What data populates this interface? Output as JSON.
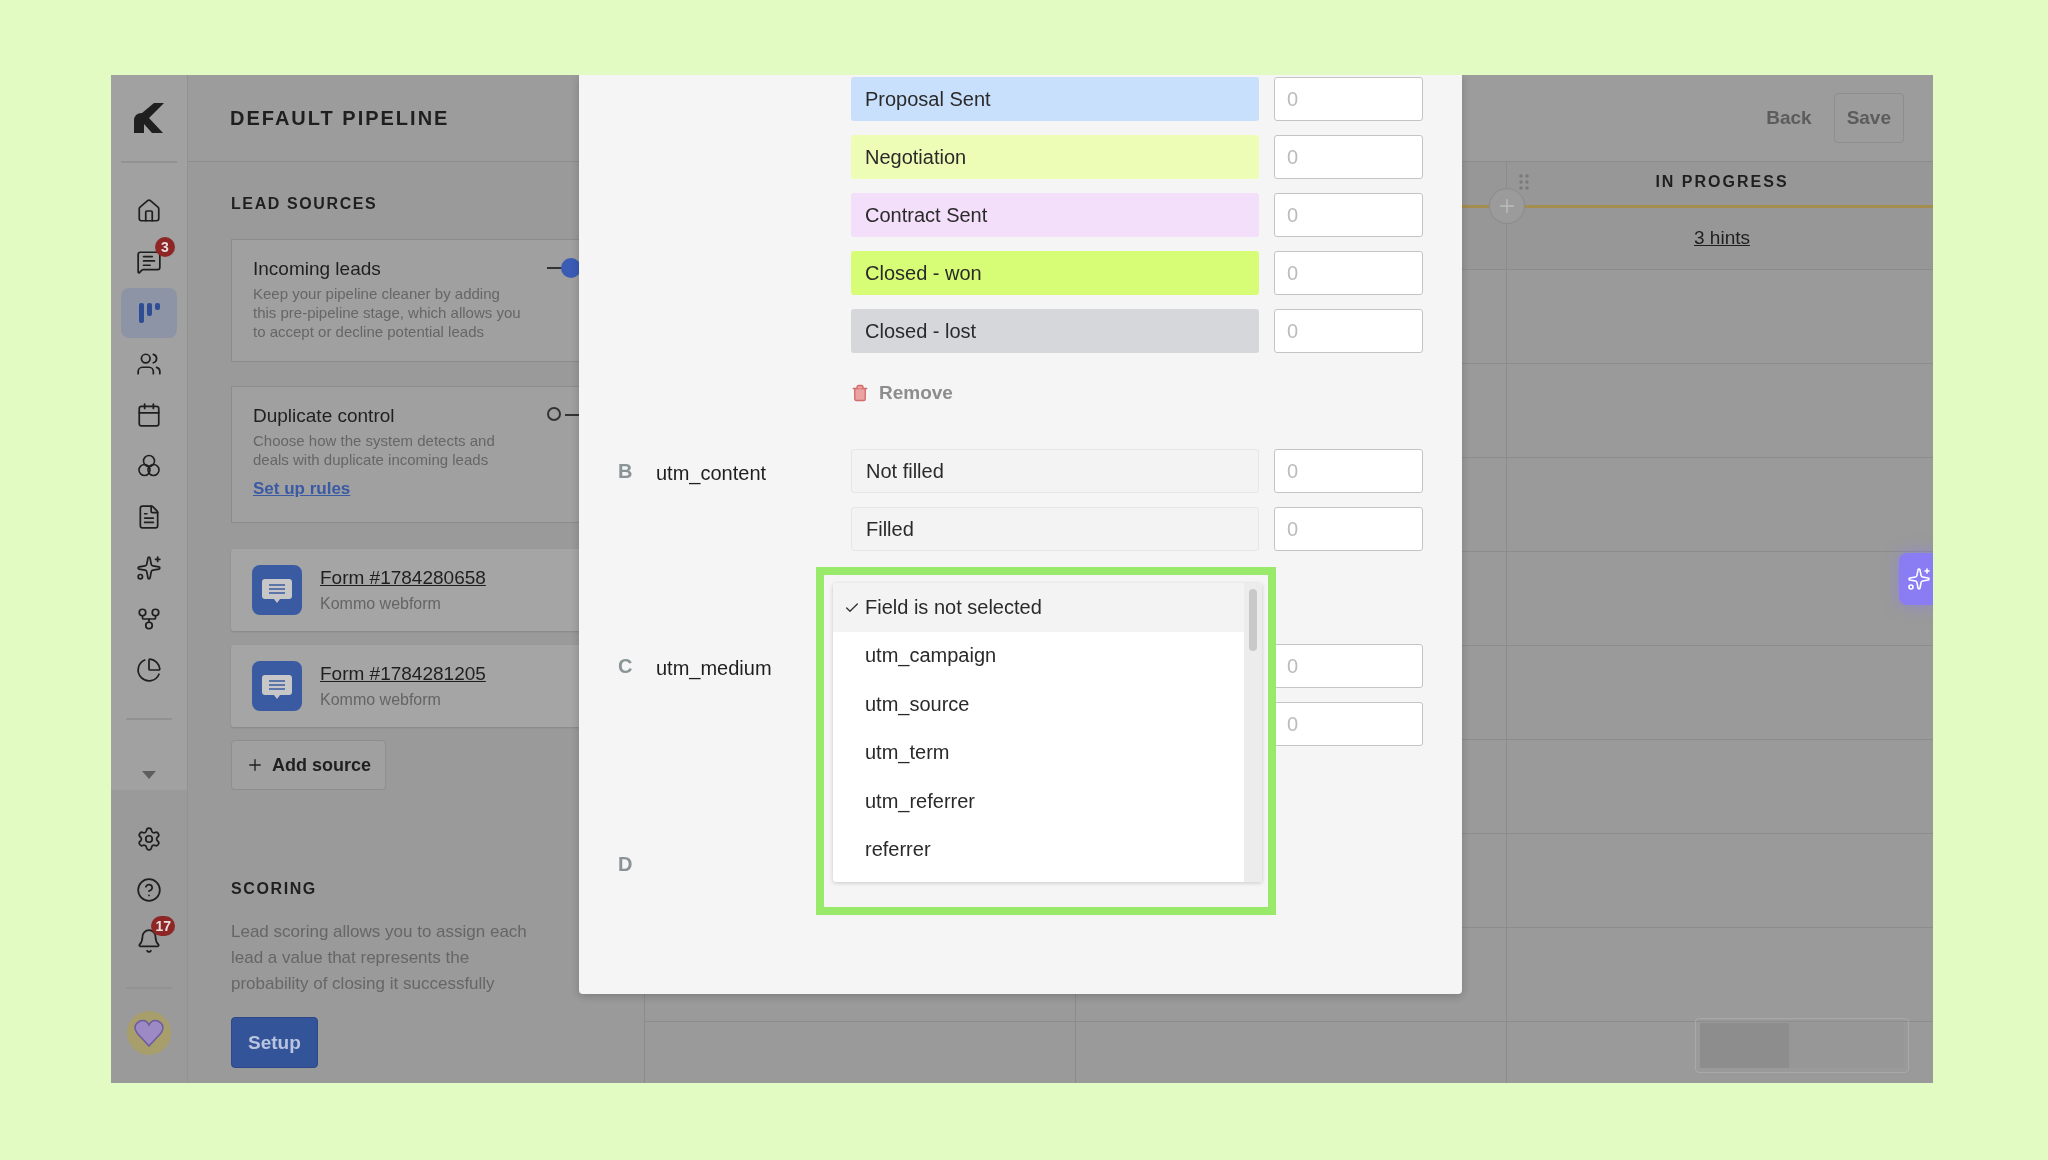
{
  "sidebar": {
    "items": [
      {
        "kind": "home",
        "selected": false
      },
      {
        "kind": "chat",
        "badge": "3",
        "selected": false
      },
      {
        "kind": "pipeline",
        "selected": true
      },
      {
        "kind": "contacts",
        "selected": false
      },
      {
        "kind": "calendar",
        "selected": false
      },
      {
        "kind": "circles",
        "selected": false
      },
      {
        "kind": "document",
        "selected": false
      },
      {
        "kind": "sparkles",
        "selected": false
      },
      {
        "kind": "branch",
        "selected": false
      },
      {
        "kind": "chart",
        "selected": false
      }
    ],
    "bottom_items": [
      {
        "kind": "settings",
        "selected": false
      },
      {
        "kind": "help",
        "selected": false
      },
      {
        "kind": "bell",
        "badge": "17",
        "selected": false
      }
    ]
  },
  "header": {
    "title": "DEFAULT PIPELINE",
    "back_link": "Back",
    "save_button": "Save"
  },
  "lead_sources": {
    "heading": "LEAD SOURCES",
    "settings": [
      {
        "title": "Incoming leads",
        "description": "Keep your pipeline cleaner by adding\nthis pre-pipeline stage, which allows you\nto accept or decline potential leads",
        "on": true
      },
      {
        "title": "Duplicate control",
        "description": "Choose how the system detects and\ndeals with duplicate incoming leads",
        "on": false,
        "link": "Set up rules"
      }
    ],
    "forms": [
      {
        "name": "Form #1784280658",
        "type": "Kommo webform"
      },
      {
        "name": "Form #1784281205",
        "type": "Kommo webform"
      }
    ],
    "add_button": "Add source"
  },
  "scoring": {
    "heading": "SCORING",
    "description": "Lead scoring allows you to assign each\nlead a value that represents the\nprobability of closing it successfully",
    "button": "Setup"
  },
  "board": {
    "stage": "IN PROGRESS",
    "hints_link": "3 hints"
  },
  "modal": {
    "groups": [
      {
        "rows": [
          {
            "label": "Proposal Sent",
            "color": "#c9e0fd",
            "placeholder": "0"
          },
          {
            "label": "Negotiation",
            "color": "#eefdb6",
            "placeholder": "0"
          },
          {
            "label": "Contract Sent",
            "color": "#f4dffa",
            "placeholder": "0"
          },
          {
            "label": "Closed - won",
            "color": "#d6fd75",
            "placeholder": "0"
          },
          {
            "label": "Closed - lost",
            "color": "#d6d7da",
            "placeholder": "0"
          }
        ],
        "remove": "Remove"
      },
      {
        "letter": "B",
        "field": "utm_content",
        "rows": [
          {
            "label": "Not filled",
            "placeholder": "0"
          },
          {
            "label": "Filled",
            "placeholder": "0"
          }
        ]
      },
      {
        "letter": "C",
        "field": "utm_medium",
        "rows": [
          {
            "placeholder": "0"
          },
          {
            "placeholder": "0"
          }
        ]
      },
      {
        "letter": "D"
      }
    ],
    "dropdown": {
      "options": [
        {
          "label": "Field is not selected",
          "selected": true
        },
        {
          "label": "utm_campaign",
          "selected": false
        },
        {
          "label": "utm_source",
          "selected": false
        },
        {
          "label": "utm_term",
          "selected": false
        },
        {
          "label": "utm_referrer",
          "selected": false
        },
        {
          "label": "referrer",
          "selected": false
        }
      ]
    }
  }
}
